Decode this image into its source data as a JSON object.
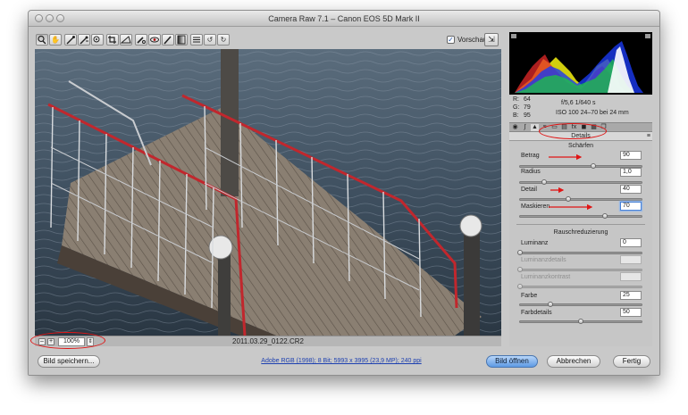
{
  "window": {
    "title": "Camera Raw 7.1 – Canon EOS 5D Mark II"
  },
  "toolbar": {
    "tools": [
      "zoom-icon",
      "hand-icon",
      "white-balance-icon",
      "color-sampler-icon",
      "target-adjust-icon",
      "crop-icon",
      "straighten-icon",
      "spot-removal-icon",
      "red-eye-icon",
      "adjustment-brush-icon",
      "graduated-filter-icon",
      "preferences-icon",
      "rotate-left-icon",
      "rotate-right-icon"
    ],
    "preview_label": "Vorschau",
    "preview_checked": true
  },
  "status": {
    "zoom": "100%",
    "filename": "2011.03.29_0122.CR2"
  },
  "exif": {
    "r_label": "R:",
    "g_label": "G:",
    "b_label": "B:",
    "r": "64",
    "g": "79",
    "b": "95",
    "aperture_shutter": "f/5,6   1/640 s",
    "iso_lens": "ISO 100   24–70 bei 24 mm"
  },
  "panel": {
    "title": "Details",
    "sharpen": {
      "title": "Schärfen",
      "sliders": [
        {
          "label": "Betrag",
          "value": "90",
          "fraction": 0.6
        },
        {
          "label": "Radius",
          "value": "1,0",
          "fraction": 0.2
        },
        {
          "label": "Detail",
          "value": "40",
          "fraction": 0.4
        },
        {
          "label": "Maskieren",
          "value": "70",
          "fraction": 0.7
        }
      ]
    },
    "noise": {
      "title": "Rauschreduzierung",
      "sliders": [
        {
          "label": "Luminanz",
          "value": "0",
          "fraction": 0.0,
          "disabled": false
        },
        {
          "label": "Luminanzdetails",
          "value": "",
          "fraction": 0.0,
          "disabled": true
        },
        {
          "label": "Luminanzkontrast",
          "value": "",
          "fraction": 0.0,
          "disabled": true
        },
        {
          "label": "Farbe",
          "value": "25",
          "fraction": 0.25,
          "disabled": false
        },
        {
          "label": "Farbdetails",
          "value": "50",
          "fraction": 0.5,
          "disabled": false
        }
      ]
    }
  },
  "bottom": {
    "save_label": "Bild speichern...",
    "workflow_link": "Adobe RGB (1998); 8 Bit; 5993 x 3995 (23,9 MP); 240 ppi",
    "open_label": "Bild öffnen",
    "cancel_label": "Abbrechen",
    "done_label": "Fertig"
  },
  "colors": {
    "accent": "#5d9ae4",
    "annotation": "#e01515"
  }
}
